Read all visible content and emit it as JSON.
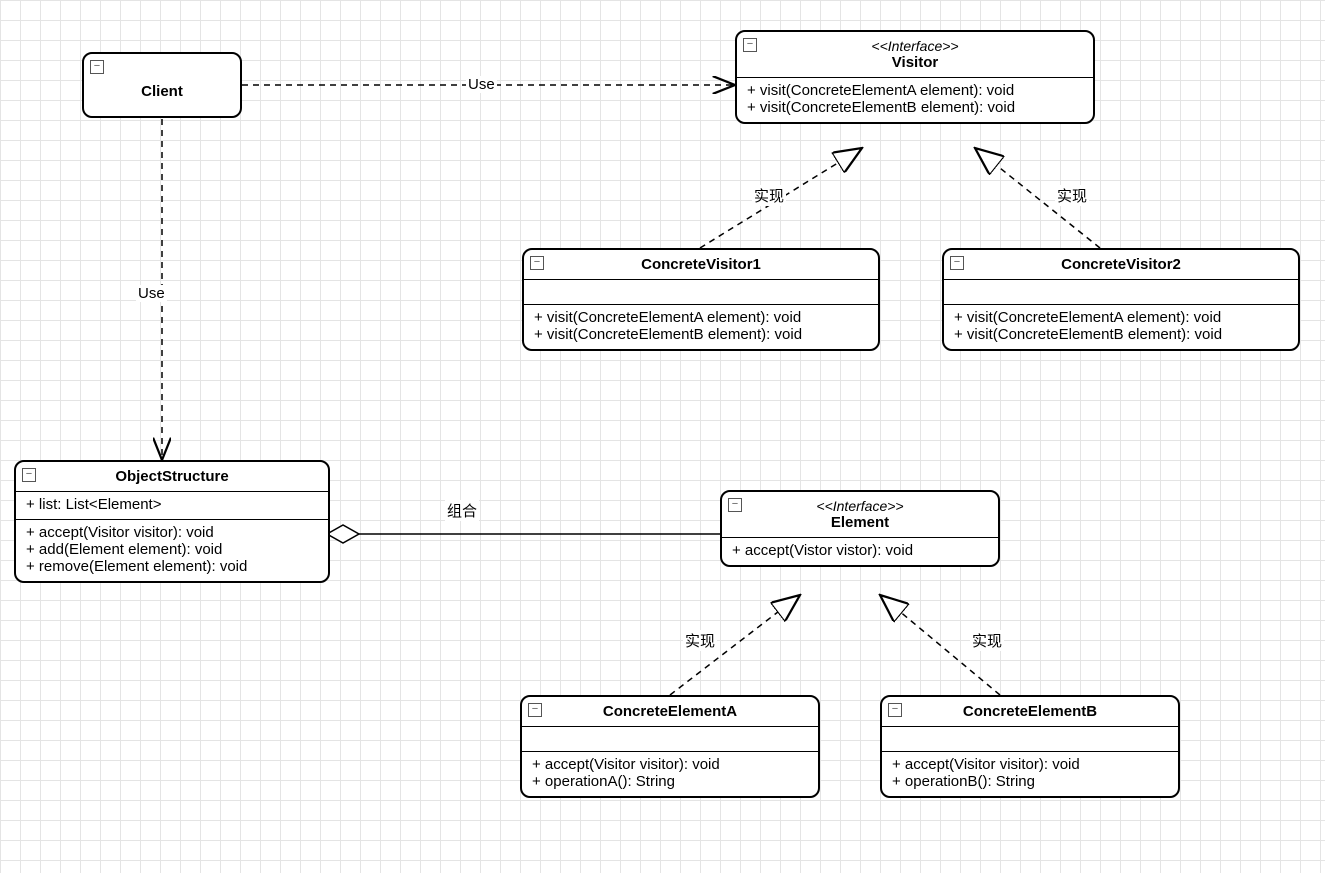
{
  "client": {
    "name": "Client"
  },
  "visitor": {
    "stereotype": "<<Interface>>",
    "name": "Visitor",
    "methods": [
      "+ visit(ConcreteElementA element): void",
      "+ visit(ConcreteElementB element): void"
    ]
  },
  "concreteVisitor1": {
    "name": "ConcreteVisitor1",
    "methods": [
      "+ visit(ConcreteElementA element): void",
      "+ visit(ConcreteElementB element): void"
    ]
  },
  "concreteVisitor2": {
    "name": "ConcreteVisitor2",
    "methods": [
      "+ visit(ConcreteElementA element): void",
      "+ visit(ConcreteElementB element): void"
    ]
  },
  "objectStructure": {
    "name": "ObjectStructure",
    "attrs": [
      "+ list: List<Element>"
    ],
    "methods": [
      "+ accept(Visitor visitor): void",
      "+ add(Element element): void",
      "+ remove(Element element): void"
    ]
  },
  "element": {
    "stereotype": "<<Interface>>",
    "name": "Element",
    "methods": [
      "+ accept(Vistor vistor): void"
    ]
  },
  "concreteElementA": {
    "name": "ConcreteElementA",
    "methods": [
      "+ accept(Visitor visitor): void",
      "+ operationA(): String"
    ]
  },
  "concreteElementB": {
    "name": "ConcreteElementB",
    "methods": [
      "+ accept(Visitor visitor): void",
      "+ operationB(): String"
    ]
  },
  "labels": {
    "use1": "Use",
    "use2": "Use",
    "impl1": "实现",
    "impl2": "实现",
    "impl3": "实现",
    "impl4": "实现",
    "compose": "组合"
  },
  "collapseGlyph": "−"
}
